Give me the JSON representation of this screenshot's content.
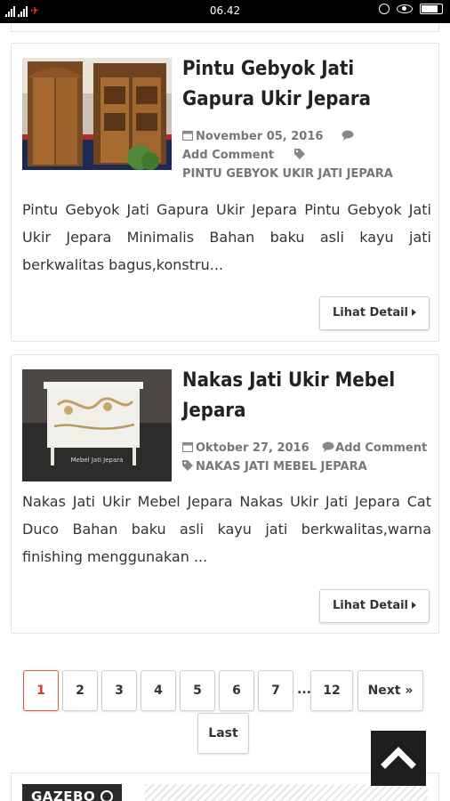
{
  "statusbar": {
    "time": "06.42"
  },
  "posts": [
    {
      "title": "Pintu Gebyok Jati Gapura Ukir Jepara",
      "date": "November 05, 2016",
      "comment": "Add Comment",
      "category": "PINTU GEBYOK UKIR JATI JEPARA",
      "excerpt": "Pintu Gebyok Jati Gapura Ukir Jepara   Pintu Gebyok Jati Ukir Jepara Minimalis Bahan baku asli kayu jati berkwalitas bagus,konstru...",
      "button": "Lihat Detail"
    },
    {
      "title": "Nakas Jati Ukir Mebel Jepara",
      "date": "Oktober 27, 2016",
      "comment": "Add Comment",
      "category": "NAKAS JATI MEBEL JEPARA",
      "excerpt": "Nakas Jati Ukir Mebel Jepara Nakas Ukir Jati Jepara Cat Duco Bahan baku asli kayu jati berkwalitas,warna finishing menggunakan ...",
      "watermark": "Mebel Jati Jepara",
      "button": "Lihat Detail"
    }
  ],
  "pagination": {
    "pages": [
      "1",
      "2",
      "3",
      "4",
      "5",
      "6",
      "7"
    ],
    "dots": "...",
    "last_page": "12",
    "next": "Next »",
    "last": "Last",
    "active": "1"
  },
  "widget": {
    "title": "GAZEBO"
  },
  "colors": {
    "active_page": "#dd3333",
    "title": "#222222",
    "meta": "#777777"
  },
  "icons": [
    "calendar-icon",
    "comment-icon",
    "tag-icon",
    "caret-right-icon",
    "chevron-up-icon",
    "circle-arrow-icon"
  ]
}
